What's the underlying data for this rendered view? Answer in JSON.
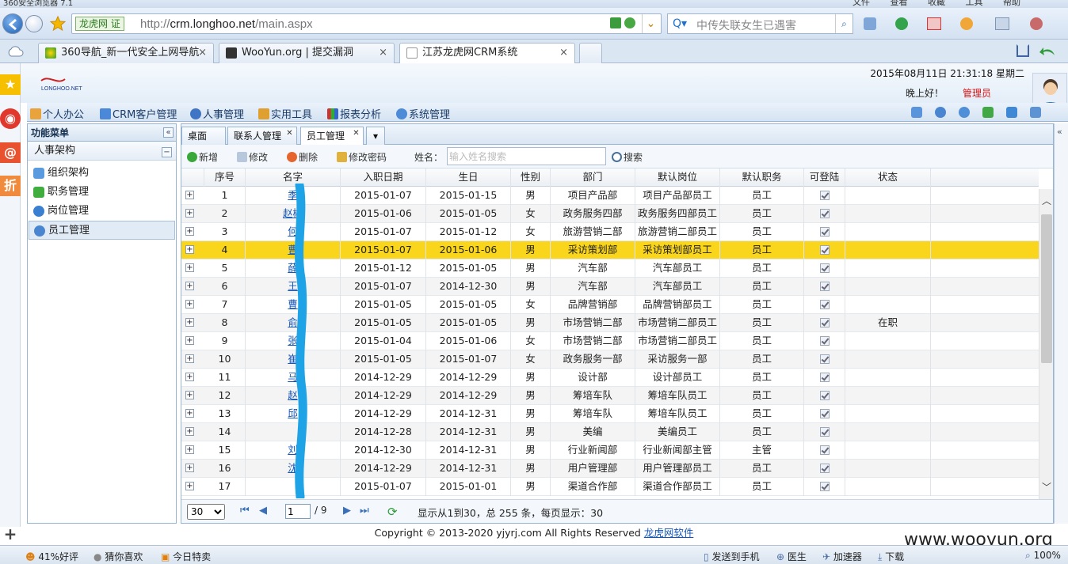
{
  "browser": {
    "window_title": "360安全浏览器 7.1",
    "top_menus": [
      "文件",
      "查看",
      "收藏",
      "工具",
      "帮助"
    ],
    "address_badge": "龙虎网 证",
    "url_prefix": "http://",
    "url_host": "crm.longhoo.net",
    "url_path": "/main.aspx",
    "search_placeholder": "中传失联女生已遇害",
    "tabs": [
      {
        "title": "360导航_新一代安全上网导航",
        "close": "×"
      },
      {
        "title": "WooYun.org | 提交漏洞",
        "close": "×"
      },
      {
        "title": "江苏龙虎网CRM系统",
        "close": "×"
      }
    ]
  },
  "header": {
    "logo_text": "LONGHOO.NET",
    "datetime": "2015年08月11日 21:31:18 星期二",
    "greeting": "晚上好！",
    "user": "管理员"
  },
  "main_menu": [
    "个人办公",
    "CRM客户管理",
    "人事管理",
    "实用工具",
    "报表分析",
    "系统管理"
  ],
  "sidebar": {
    "title": "功能菜单",
    "collapse": "«",
    "section": "人事架构",
    "section_toggle": "−",
    "items": [
      "组织架构",
      "职务管理",
      "岗位管理",
      "员工管理"
    ]
  },
  "content_tabs": [
    "桌面",
    "联系人管理",
    "员工管理"
  ],
  "toolbar": {
    "add": "新增",
    "edit": "修改",
    "delete": "删除",
    "change_password": "修改密码",
    "name_label": "姓名：",
    "name_placeholder": "输入姓名搜索",
    "search": "搜索"
  },
  "table": {
    "headers": [
      "序号",
      "名字",
      "入职日期",
      "生日",
      "性别",
      "部门",
      "默认岗位",
      "默认职务",
      "可登陆",
      "状态"
    ],
    "rows": [
      {
        "no": "1",
        "name": "季",
        "hire": "2015-01-07",
        "birth": "2015-01-15",
        "sex": "男",
        "dept": "项目产品部",
        "post": "项目产品部员工",
        "duty": "员工",
        "status": ""
      },
      {
        "no": "2",
        "name": "赵彬",
        "hire": "2015-01-06",
        "birth": "2015-01-05",
        "sex": "女",
        "dept": "政务服务四部",
        "post": "政务服务四部员工",
        "duty": "员工",
        "status": ""
      },
      {
        "no": "3",
        "name": "何",
        "hire": "2015-01-07",
        "birth": "2015-01-12",
        "sex": "女",
        "dept": "旅游营销二部",
        "post": "旅游营销二部员工",
        "duty": "员工",
        "status": ""
      },
      {
        "no": "4",
        "name": "曹",
        "hire": "2015-01-07",
        "birth": "2015-01-06",
        "sex": "男",
        "dept": "采访策划部",
        "post": "采访策划部员工",
        "duty": "员工",
        "status": ""
      },
      {
        "no": "5",
        "name": "薛",
        "hire": "2015-01-12",
        "birth": "2015-01-05",
        "sex": "男",
        "dept": "汽车部",
        "post": "汽车部员工",
        "duty": "员工",
        "status": ""
      },
      {
        "no": "6",
        "name": "王",
        "hire": "2015-01-07",
        "birth": "2014-12-30",
        "sex": "男",
        "dept": "汽车部",
        "post": "汽车部员工",
        "duty": "员工",
        "status": ""
      },
      {
        "no": "7",
        "name": "曹",
        "hire": "2015-01-05",
        "birth": "2015-01-05",
        "sex": "女",
        "dept": "品牌营销部",
        "post": "品牌营销部员工",
        "duty": "员工",
        "status": ""
      },
      {
        "no": "8",
        "name": "俞",
        "hire": "2015-01-05",
        "birth": "2015-01-05",
        "sex": "男",
        "dept": "市场营销二部",
        "post": "市场营销二部员工",
        "duty": "员工",
        "status": "在职"
      },
      {
        "no": "9",
        "name": "张",
        "hire": "2015-01-04",
        "birth": "2015-01-06",
        "sex": "女",
        "dept": "市场营销二部",
        "post": "市场营销二部员工",
        "duty": "员工",
        "status": ""
      },
      {
        "no": "10",
        "name": "崔",
        "hire": "2015-01-05",
        "birth": "2015-01-07",
        "sex": "女",
        "dept": "政务服务一部",
        "post": "采访服务一部",
        "duty": "员工",
        "status": ""
      },
      {
        "no": "11",
        "name": "马",
        "hire": "2014-12-29",
        "birth": "2014-12-29",
        "sex": "男",
        "dept": "设计部",
        "post": "设计部员工",
        "duty": "员工",
        "status": ""
      },
      {
        "no": "12",
        "name": "赵",
        "hire": "2014-12-29",
        "birth": "2014-12-29",
        "sex": "男",
        "dept": "筹培车队",
        "post": "筹培车队员工",
        "duty": "员工",
        "status": ""
      },
      {
        "no": "13",
        "name": "邱",
        "hire": "2014-12-29",
        "birth": "2014-12-31",
        "sex": "男",
        "dept": "筹培车队",
        "post": "筹培车队员工",
        "duty": "员工",
        "status": ""
      },
      {
        "no": "14",
        "name": "",
        "hire": "2014-12-28",
        "birth": "2014-12-31",
        "sex": "男",
        "dept": "美编",
        "post": "美编员工",
        "duty": "员工",
        "status": ""
      },
      {
        "no": "15",
        "name": "刘",
        "hire": "2014-12-30",
        "birth": "2014-12-31",
        "sex": "男",
        "dept": "行业新闻部",
        "post": "行业新闻部主管",
        "duty": "主管",
        "status": ""
      },
      {
        "no": "16",
        "name": "沈",
        "hire": "2014-12-29",
        "birth": "2014-12-31",
        "sex": "男",
        "dept": "用户管理部",
        "post": "用户管理部员工",
        "duty": "员工",
        "status": ""
      },
      {
        "no": "17",
        "name": "",
        "hire": "2015-01-07",
        "birth": "2015-01-01",
        "sex": "男",
        "dept": "渠道合作部",
        "post": "渠道合作部员工",
        "duty": "员工",
        "status": ""
      }
    ],
    "expand_symbol": "+"
  },
  "pager": {
    "page_size": "30",
    "current_page": "1",
    "total_pages": "/ 9",
    "summary": "显示从1到30，总 255 条，每页显示：30"
  },
  "footer": {
    "copyright": "Copyright © 2013-2020 yjyrj.com All Rights Reserved ",
    "company_link": "龙虎网软件"
  },
  "statusbar": {
    "rating": "41%好评",
    "guess": "猜你喜欢",
    "deals": "今日特卖",
    "send_phone": "发送到手机",
    "doctor": "医生",
    "accelerator": "加速器",
    "download": "下载",
    "zoom": "100%"
  },
  "watermark": "www.wooyun.org",
  "colors": {
    "highlight_row": "#f9d51b",
    "link": "#1455b8",
    "admin": "#d41010",
    "redaction": "#1ea3e6"
  }
}
